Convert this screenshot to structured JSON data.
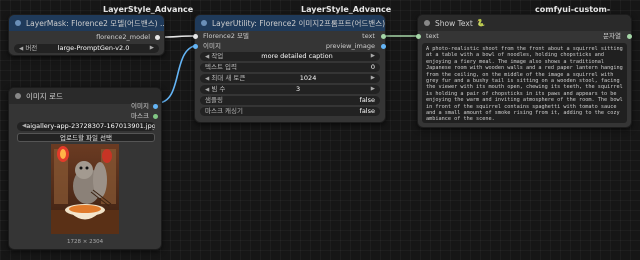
{
  "groups": {
    "left": "LayerStyle_Advance",
    "middle": "LayerStyle_Advance",
    "right": "comfyui-custom-scripts"
  },
  "model_node": {
    "title": "LayerMask: Florence2 모델(어드밴스) ...",
    "output": "florence2_model",
    "version_label": "버전",
    "version_value": "large-PromptGen-v2.0"
  },
  "load_image_node": {
    "title": "이미지 로드",
    "output_image": "이미지",
    "output_mask": "마스크",
    "file_value": "aigallery-app-23728307-167013901.jpg",
    "upload_button": "업로드할 파일 선택",
    "image_size": "1728 × 2304"
  },
  "utility_node": {
    "title": "LayerUtility: Florence2 이미지2프롬프트(어드밴스)",
    "input_model": "Florence2 모델",
    "input_image": "이미지",
    "output_text": "text",
    "output_preview": "preview_image",
    "task_label": "작업",
    "task_value": "more detailed caption",
    "text_input_label": "텍스트 입력",
    "text_input_value": "0",
    "max_tokens_label": "최대 새 토큰",
    "max_tokens_value": "1024",
    "beams_label": "빔 수",
    "beams_value": "3",
    "sampling_label": "샘플링",
    "sampling_value": "false",
    "cache_label": "마스크 캐싱기",
    "cache_value": "false"
  },
  "show_text_node": {
    "title": "Show Text",
    "input_text": "text",
    "output_label": "문자열",
    "content": "A photo-realistic shoot from the front about a squirrel sitting at a table with a bowl of noodles, holding chopsticks and enjoying a fiery meal. The image also shows a traditional Japanese room with wooden walls and a red paper lantern hanging from the ceiling, on the middle of the image a squirrel with grey fur and a bushy tail is sitting on a wooden stool, facing the viewer with its mouth open, chewing its teeth, the squirrel is holding a pair of chopsticks in its paws and appears to be enjoying the warm and inviting atmosphere of the room. The bowl in front of the squirrel contains spaghetti with tomato sauce and a small amount of smoke rising from it, adding to the cozy ambiance of the scene."
  },
  "colors": {
    "model_port": "#e6e6e6",
    "image_port": "#64b5f6",
    "mask_port": "#81c784",
    "text_port": "#a5d6a7"
  }
}
